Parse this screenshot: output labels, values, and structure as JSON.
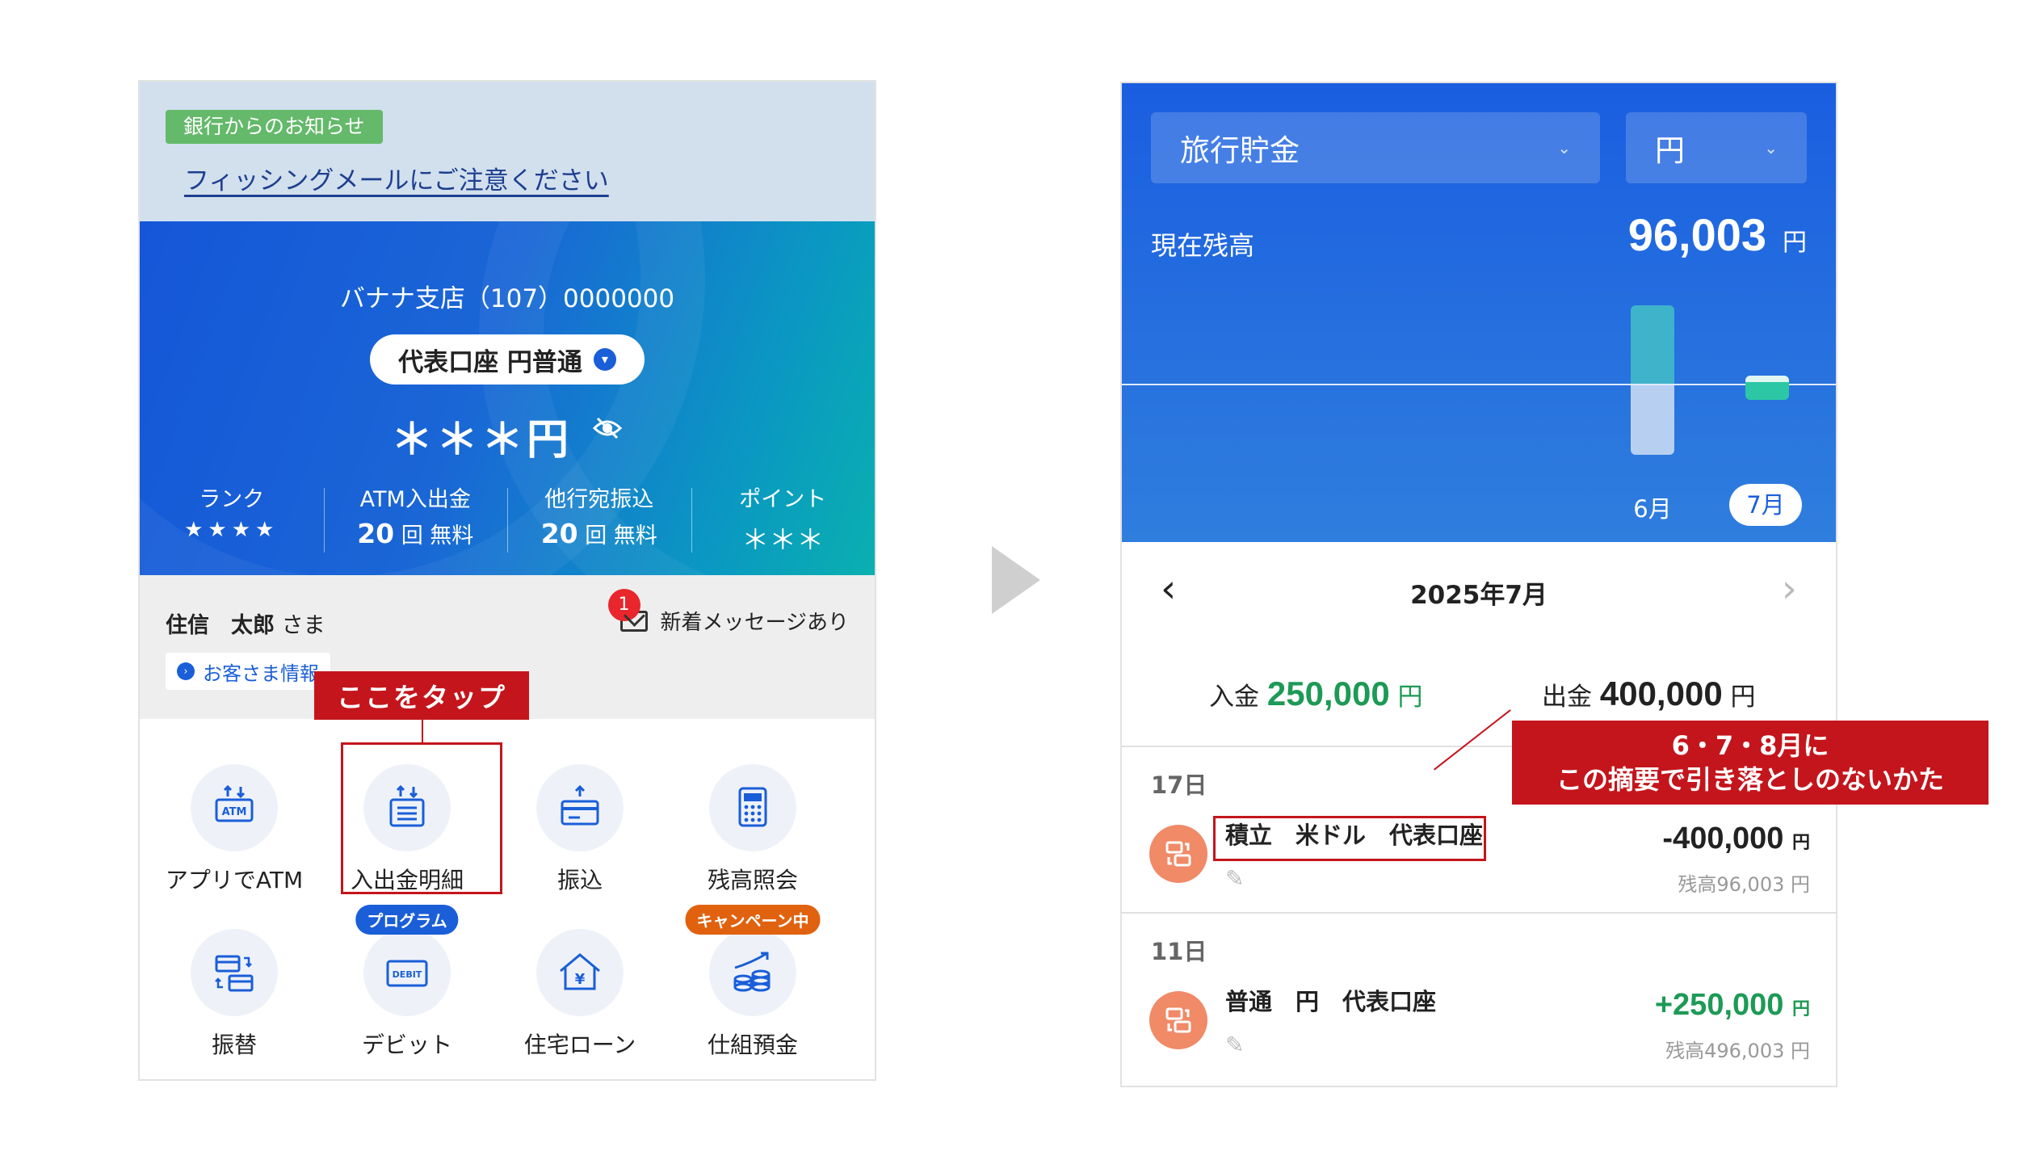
{
  "left": {
    "notice": {
      "badge": "銀行からのお知らせ",
      "link": "フィッシングメールにご注意ください"
    },
    "account": {
      "branch": "バナナ支店（107）0000000",
      "selector": "代表口座 円普通",
      "balance_masked": "＊＊＊円"
    },
    "stats": [
      {
        "label": "ランク",
        "value": "★★★★"
      },
      {
        "label": "ATM入出金",
        "num": "20",
        "unit": "回 無料"
      },
      {
        "label": "他行宛振込",
        "num": "20",
        "unit": "回 無料"
      },
      {
        "label": "ポイント",
        "value": "＊＊＊"
      }
    ],
    "customer": {
      "surname": "住信",
      "given": "太郎",
      "honorific": "さま",
      "info_button": "お客さま情報",
      "messages_label": "新着メッセージあり",
      "messages_count": "1"
    },
    "menu": [
      {
        "label": "アプリでATM",
        "icon": "atm-icon"
      },
      {
        "label": "入出金明細",
        "icon": "statement-icon"
      },
      {
        "label": "振込",
        "icon": "transfer-card-icon"
      },
      {
        "label": "残高照会",
        "icon": "calculator-icon"
      },
      {
        "label": "振替",
        "icon": "account-transfer-icon"
      },
      {
        "label": "デビット",
        "icon": "debit-card-icon",
        "tag": "プログラム",
        "tag_color": "#1a5ed8"
      },
      {
        "label": "住宅ローン",
        "icon": "house-yen-icon"
      },
      {
        "label": "仕組預金",
        "icon": "coins-growth-icon",
        "tag": "キャンペーン中",
        "tag_color": "#e0620f"
      }
    ],
    "callout": "ここをタップ"
  },
  "right": {
    "account_select": "旅行貯金",
    "currency_select": "円",
    "balance_label": "現在残高",
    "balance_value": "96,003",
    "balance_unit": "円",
    "chart_months": [
      "6月",
      "7月"
    ],
    "month_title": "2025年7月",
    "income_label": "入金",
    "income_value": "250,000",
    "outgo_label": "出金",
    "outgo_value": "400,000",
    "unit": "円",
    "transactions": [
      {
        "day": "17日",
        "title": "積立　米ドル　代表口座",
        "amount": "-400,000",
        "unit": "円",
        "balance": "残高96,003 円",
        "amount_color": "#222222"
      },
      {
        "day": "11日",
        "title": "普通　円　代表口座",
        "amount": "+250,000",
        "unit": "円",
        "balance": "残高496,003 円",
        "amount_color": "#1d9a55"
      }
    ],
    "note_line1": "6・7・8月に",
    "note_line2": "この摘要で引き落としのないかた"
  },
  "colors": {
    "accent": "#1a5ed8",
    "callout": "#c4151c",
    "income": "#1d9a55"
  }
}
